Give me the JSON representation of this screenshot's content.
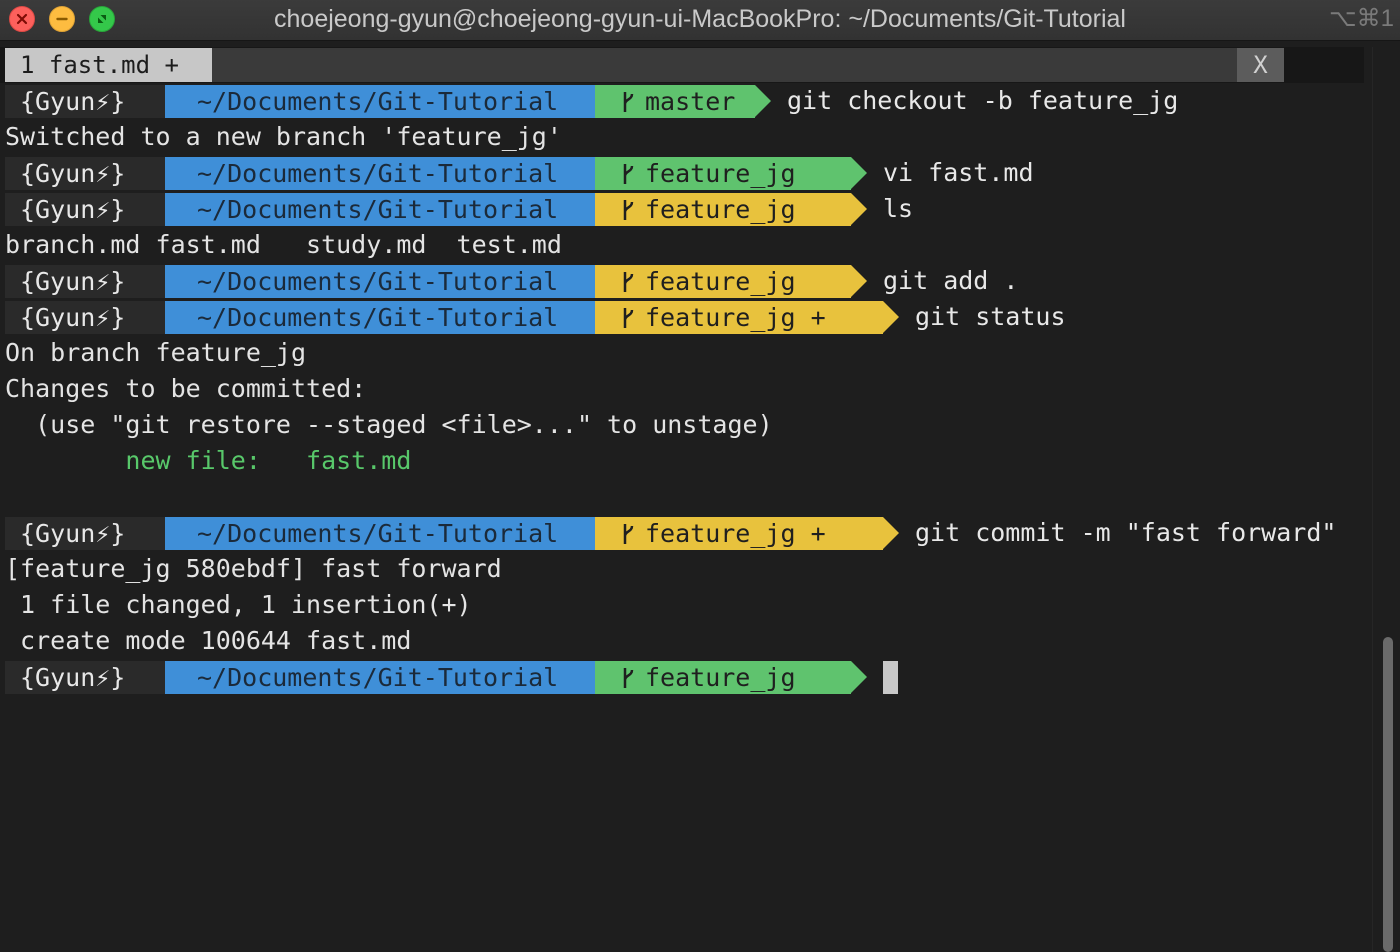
{
  "window": {
    "title": "choejeong-gyun@choejeong-gyun-ui-MacBookPro: ~/Documents/Git-Tutorial",
    "shortcut": "⌥⌘1"
  },
  "tabs": [
    {
      "label": "1 fast.md +",
      "close_label": "X"
    }
  ],
  "prompt": {
    "user": "{Gyun⚡}",
    "path": "~/Documents/Git-Tutorial"
  },
  "terminal": {
    "p1": {
      "branch": "master",
      "command": "git checkout -b feature_jg"
    },
    "o1": "Switched to a new branch 'feature_jg'",
    "p2": {
      "branch": "feature_jg",
      "command": "vi fast.md"
    },
    "p3": {
      "branch": "feature_jg",
      "command": "ls"
    },
    "o2": "branch.md fast.md   study.md  test.md",
    "p4": {
      "branch": "feature_jg",
      "command": "git add ."
    },
    "p5": {
      "branch": "feature_jg +",
      "command": "git status"
    },
    "o3": "On branch feature_jg",
    "o4": "Changes to be committed:",
    "o5": "  (use \"git restore --staged <file>...\" to unstage)",
    "o6": "        new file:   fast.md",
    "p6": {
      "branch": "feature_jg +",
      "command": "git commit -m \"fast forward\""
    },
    "o7": "[feature_jg 580ebdf] fast forward",
    "o8": " 1 file changed, 1 insertion(+)",
    "o9": " create mode 100644 fast.md",
    "p7": {
      "branch": "feature_jg",
      "command": ""
    }
  },
  "colors": {
    "path_bg": "#3f8fd8",
    "branch_clean": "#5fc36e",
    "branch_dirty": "#e8c23d",
    "user_bg": "#2a2a2a"
  }
}
